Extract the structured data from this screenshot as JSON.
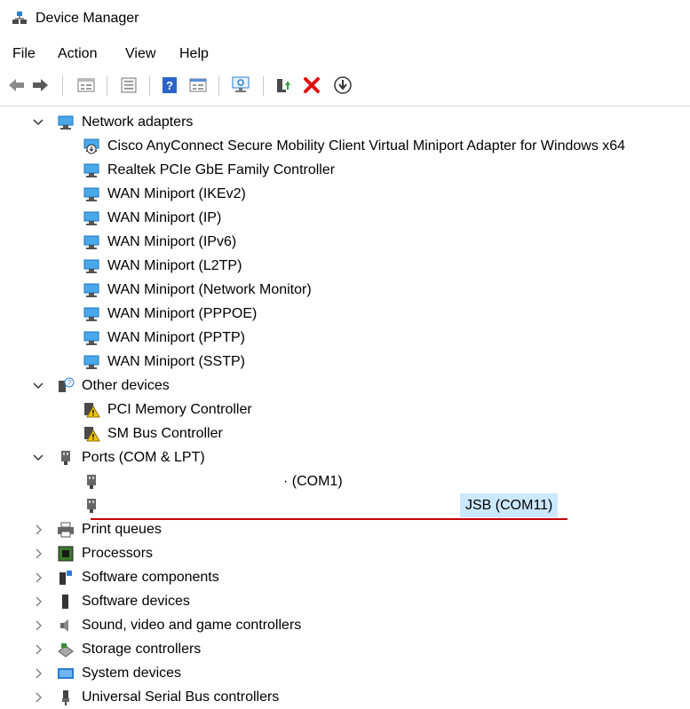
{
  "window": {
    "title": "Device Manager"
  },
  "menu": [
    {
      "label": "File"
    },
    {
      "label": "Action"
    },
    {
      "label": "View"
    },
    {
      "label": "Help"
    }
  ],
  "toolbar": {
    "icons": [
      "back-icon",
      "forward-icon",
      "properties-icon",
      "view-icon",
      "help-icon",
      "details-icon",
      "scan-hardware-icon",
      "update-driver-icon",
      "uninstall-icon",
      "download-icon"
    ]
  },
  "tree": {
    "network_adapters": {
      "label": "Network adapters",
      "children": [
        "Cisco AnyConnect Secure Mobility Client Virtual Miniport Adapter for Windows x64",
        "Realtek PCIe GbE Family Controller",
        "WAN Miniport (IKEv2)",
        "WAN Miniport (IP)",
        "WAN Miniport (IPv6)",
        "WAN Miniport (L2TP)",
        "WAN Miniport (Network Monitor)",
        "WAN Miniport (PPPOE)",
        "WAN Miniport (PPTP)",
        "WAN Miniport (SSTP)"
      ]
    },
    "other_devices": {
      "label": "Other devices",
      "children": [
        "PCI Memory Controller",
        "SM Bus Controller"
      ]
    },
    "ports": {
      "label": "Ports (COM & LPT)",
      "children": [
        "· (COM1)",
        "JSB (COM11)"
      ]
    },
    "collapsed": [
      "Print queues",
      "Processors",
      "Software components",
      "Software devices",
      "Sound, video and game controllers",
      "Storage controllers",
      "System devices",
      "Universal Serial Bus controllers"
    ]
  },
  "colors": {
    "selection": "#cce8ff",
    "annotation": "#c40000",
    "accent": "#1e73be"
  }
}
